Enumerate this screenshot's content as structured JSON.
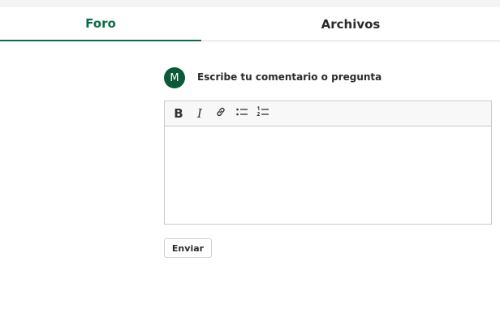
{
  "tabs": [
    {
      "label": "Foro",
      "active": true
    },
    {
      "label": "Archivos",
      "active": false
    }
  ],
  "composer": {
    "avatar_initial": "M",
    "prompt": "Escribe tu comentario o pregunta",
    "toolbar": {
      "bold": "B",
      "italic": "I",
      "icons": [
        "link-icon",
        "bulleted-list-icon",
        "numbered-list-icon"
      ]
    },
    "send_label": "Enviar"
  },
  "colors": {
    "accent": "#0c6b45",
    "avatar_bg": "#0c5a3a",
    "text": "#2b2b2b",
    "border": "#c9c9c9"
  }
}
